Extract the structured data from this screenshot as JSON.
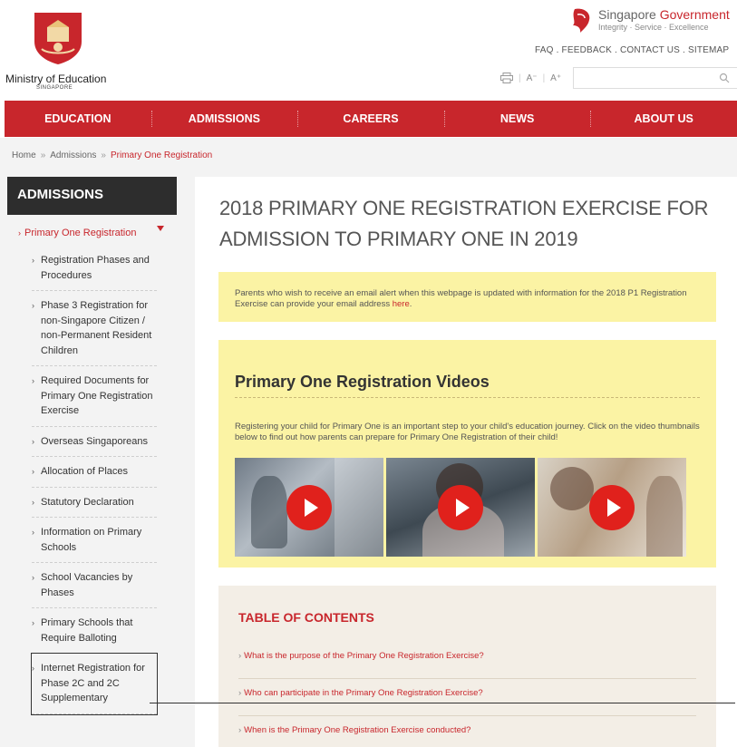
{
  "header": {
    "ministry_name": "Ministry of Education",
    "ministry_sub": "SINGAPORE",
    "sg_gov_part1": "Singapore",
    "sg_gov_part2": "Government",
    "sg_motto": "Integrity · Service · Excellence",
    "utility_links": "FAQ . FEEDBACK . CONTACT US . SITEMAP",
    "font_decrease": "A⁻",
    "font_increase": "A⁺",
    "search_placeholder": ""
  },
  "nav": {
    "items": [
      "EDUCATION",
      "ADMISSIONS",
      "CAREERS",
      "NEWS",
      "ABOUT US"
    ]
  },
  "breadcrumb": {
    "home": "Home",
    "admissions": "Admissions",
    "current": "Primary One Registration"
  },
  "sidebar": {
    "heading": "ADMISSIONS",
    "current": "Primary One Registration",
    "items": [
      "Registration Phases and Procedures",
      "Phase 3 Registration for non-Singapore Citizen / non-Permanent Resident Children",
      "Required Documents for Primary One Registration Exercise",
      "Overseas Singaporeans",
      "Allocation of Places",
      "Statutory Declaration",
      "Information on Primary Schools",
      "School Vacancies by Phases",
      "Primary Schools that Require Balloting",
      "Internet Registration for Phase 2C and 2C Supplementary"
    ]
  },
  "main": {
    "title": "2018 PRIMARY ONE REGISTRATION EXERCISE FOR ADMISSION TO PRIMARY ONE IN 2019",
    "notice_text": "Parents who wish to receive an email alert when this webpage is updated with information for the 2018 P1 Registration Exercise can provide your email address ",
    "notice_link": "here",
    "notice_end": ".",
    "videos_title": "Primary One Registration Videos",
    "videos_desc": "Registering your child for Primary One is an important step to your child's education journey. Click on the video thumbnails below to find out how parents can prepare for Primary One Registration of their child!",
    "toc_title": "TABLE OF CONTENTS",
    "toc_items": [
      "What is the purpose of the Primary One Registration Exercise?",
      "Who can participate in the Primary One Registration Exercise?",
      "When is the Primary One Registration Exercise conducted?"
    ]
  },
  "colors": {
    "brand_red": "#c8262c",
    "notice_yellow": "#fbf3a4",
    "sidebar_dark": "#2d2d2d"
  }
}
